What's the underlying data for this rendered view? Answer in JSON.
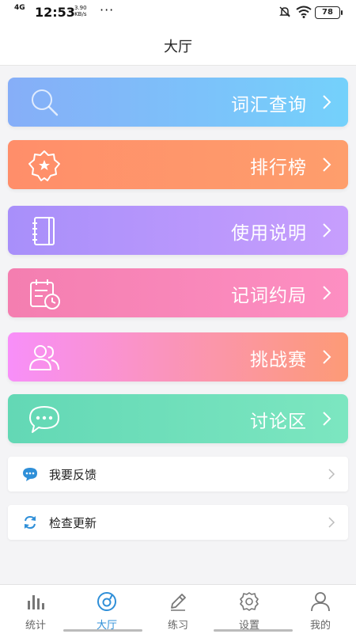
{
  "status_bar": {
    "network": "4G",
    "time": "12:53",
    "speed_value": "3.90",
    "speed_unit": "KB/s",
    "dots": "···",
    "battery": "78"
  },
  "header": {
    "title": "大厅"
  },
  "menu": [
    {
      "label": "词汇查询",
      "icon": "search-icon",
      "color": "#86aef8"
    },
    {
      "label": "排行榜",
      "icon": "badge-star-icon",
      "color": "#ff8e6a"
    },
    {
      "label": "使用说明",
      "icon": "notebook-icon",
      "color": "#a88ffa"
    },
    {
      "label": "记词约局",
      "icon": "calendar-clock-icon",
      "color": "#f47eb0"
    },
    {
      "label": "挑战赛",
      "icon": "users-icon",
      "color": "#f88ff9"
    },
    {
      "label": "讨论区",
      "icon": "chat-bubble-icon",
      "color": "#63d8b5"
    }
  ],
  "list": [
    {
      "label": "我要反馈",
      "icon": "feedback-icon"
    },
    {
      "label": "检查更新",
      "icon": "refresh-icon"
    }
  ],
  "bottom_nav": [
    {
      "label": "统计",
      "icon": "bar-chart-icon",
      "active": false
    },
    {
      "label": "大厅",
      "icon": "hall-icon",
      "active": true
    },
    {
      "label": "练习",
      "icon": "pencil-icon",
      "active": false
    },
    {
      "label": "设置",
      "icon": "gear-icon",
      "active": false
    },
    {
      "label": "我的",
      "icon": "person-icon",
      "active": false
    }
  ],
  "colors": {
    "accent": "#2f8fd8",
    "background": "#f4f4f6"
  }
}
